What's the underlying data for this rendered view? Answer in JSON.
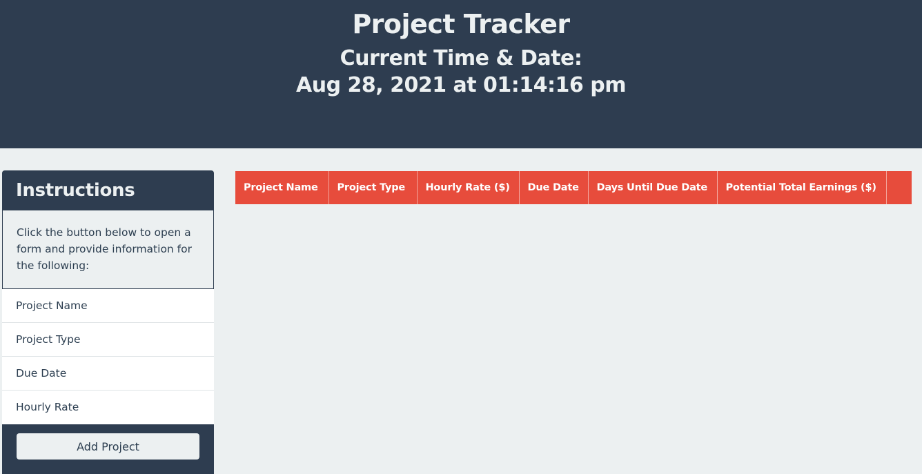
{
  "header": {
    "title": "Project Tracker",
    "time_label": "Current Time & Date:",
    "time_value": "Aug 28, 2021 at 01:14:16 pm"
  },
  "instructions": {
    "title": "Instructions",
    "description": "Click the button below to open a form and provide information for the following:",
    "items": [
      {
        "label": "Project Name"
      },
      {
        "label": "Project Type"
      },
      {
        "label": "Due Date"
      },
      {
        "label": "Hourly Rate"
      }
    ],
    "button_label": "Add Project"
  },
  "table": {
    "columns": [
      {
        "label": "Project Name"
      },
      {
        "label": "Project Type"
      },
      {
        "label": "Hourly Rate ($)"
      },
      {
        "label": "Due Date"
      },
      {
        "label": "Days Until Due Date"
      },
      {
        "label": "Potential Total Earnings ($)"
      },
      {
        "label": ""
      }
    ],
    "rows": []
  },
  "colors": {
    "header_bg": "#2e3d50",
    "page_bg": "#ecf0f1",
    "table_header_bg": "#e74c3c",
    "text_dark": "#2c3e50"
  }
}
